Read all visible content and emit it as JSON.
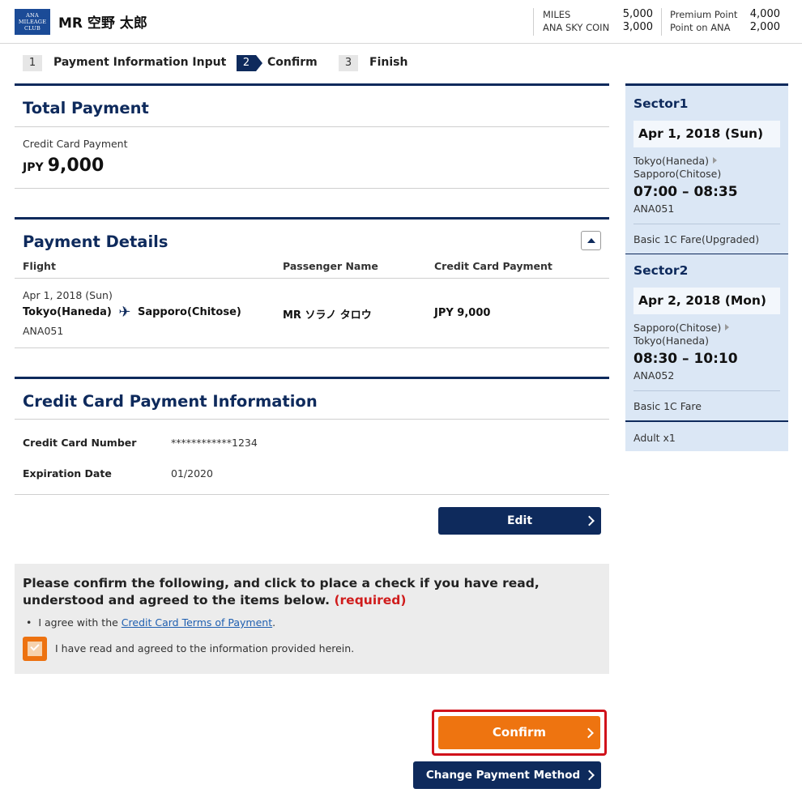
{
  "header": {
    "logo_lines": [
      "ANA",
      "MILEAGE",
      "CLUB"
    ],
    "member_name": "MR 空野 太郎",
    "miles_label": "MILES",
    "miles_value": "5,000",
    "skycoin_label": "ANA SKY COIN",
    "skycoin_value": "3,000",
    "premium_label": "Premium Point",
    "premium_value": "4,000",
    "point_ana_label": "Point on ANA",
    "point_ana_value": "2,000"
  },
  "steps": [
    {
      "num": "1",
      "label": "Payment Information Input"
    },
    {
      "num": "2",
      "label": "Confirm"
    },
    {
      "num": "3",
      "label": "Finish"
    }
  ],
  "total": {
    "title": "Total Payment",
    "method_label": "Credit Card Payment",
    "currency": "JPY",
    "amount": "9,000"
  },
  "details": {
    "title": "Payment Details",
    "col_flight": "Flight",
    "col_passenger": "Passenger Name",
    "col_payment": "Credit Card Payment",
    "row": {
      "date": "Apr 1, 2018 (Sun)",
      "from": "Tokyo(Haneda)",
      "to": "Sapporo(Chitose)",
      "flight_no": "ANA051",
      "passenger": "MR ソラノ タロウ",
      "payment": "JPY 9,000"
    }
  },
  "card": {
    "title": "Credit Card Payment Information",
    "number_label": "Credit Card Number",
    "number_value": "************1234",
    "expiry_label": "Expiration Date",
    "expiry_value": "01/2020",
    "edit_label": "Edit"
  },
  "agreement": {
    "text": "Please confirm the following, and click to place a check if you have read, understood and agreed to the items below.",
    "required": "(required)",
    "bullet_prefix": "I agree with the",
    "bullet_link": "Credit Card Terms of Payment",
    "bullet_suffix": ".",
    "checkbox_label": "I have read and agreed to the information provided herein.",
    "checked": true
  },
  "actions": {
    "confirm_label": "Confirm",
    "change_label": "Change Payment Method"
  },
  "sidebar": {
    "sector1": {
      "title": "Sector1",
      "date": "Apr 1, 2018 (Sun)",
      "from": "Tokyo(Haneda)",
      "to": "Sapporo(Chitose)",
      "time": "07:00 – 08:35",
      "flight_no": "ANA051",
      "fare": "Basic 1C Fare(Upgraded)"
    },
    "sector2": {
      "title": "Sector2",
      "date": "Apr 2, 2018 (Mon)",
      "from": "Sapporo(Chitose)",
      "to": "Tokyo(Haneda)",
      "time": "08:30 – 10:10",
      "flight_no": "ANA052",
      "fare": "Basic 1C Fare"
    },
    "passengers": "Adult x1"
  },
  "colors": {
    "navy": "#0e2a5c",
    "orange": "#ee7410",
    "required_red": "#d01c1c",
    "highlight_red": "#d0121b",
    "sidebar_bg": "#dbe7f5"
  }
}
